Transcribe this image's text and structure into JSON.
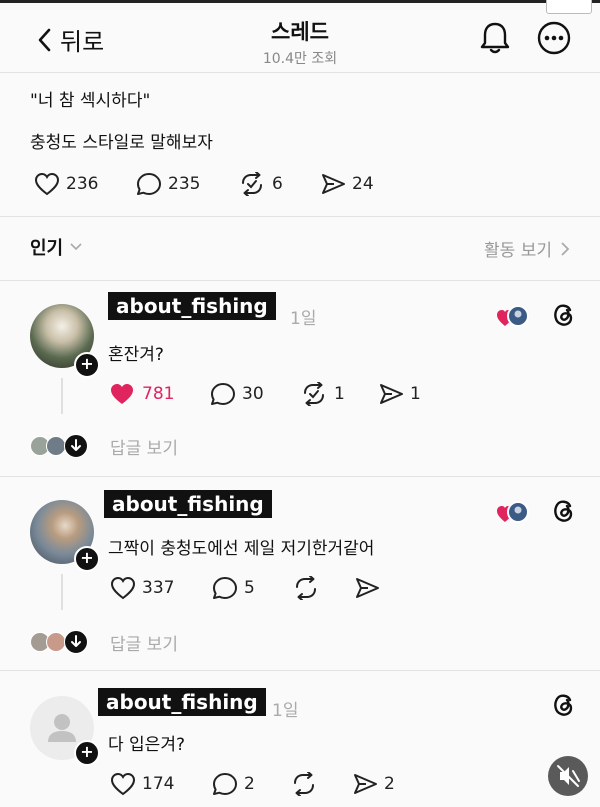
{
  "header": {
    "back_label": "뒤로",
    "title": "스레드",
    "views": "10.4만 조회"
  },
  "post": {
    "line1": "\"너 참 섹시하다\"",
    "line2": "충청도 스타일로 말해보자",
    "likes": "236",
    "comments": "235",
    "reposts": "6",
    "shares": "24"
  },
  "sort": {
    "label": "인기",
    "activity_label": "활동 보기"
  },
  "comments": [
    {
      "username": "about_fishing",
      "time": "1일",
      "text": "혼잔겨?",
      "likes": "781",
      "comments": "30",
      "reposts": "1",
      "shares": "1",
      "liked": true,
      "reply_label": "답글 보기"
    },
    {
      "username": "about_fishing",
      "time": "",
      "text": "그짝이 충청도에선 제일 저기한거같어",
      "likes": "337",
      "comments": "5",
      "reposts": "",
      "shares": "",
      "liked": false,
      "reply_label": "답글 보기"
    },
    {
      "username": "about_fishing",
      "time": "1일",
      "text": "다 입은겨?",
      "likes": "174",
      "comments": "2",
      "reposts": "",
      "shares": "2",
      "liked": false
    }
  ],
  "colors": {
    "like_active": "#e0245e",
    "muted_text": "#999999",
    "name_bg": "#111111"
  },
  "icons": [
    "chevron-left-icon",
    "bell-icon",
    "more-icon",
    "heart-icon",
    "comment-icon",
    "repost-icon",
    "share-icon",
    "threads-icon",
    "mute-icon",
    "plus-icon",
    "chevron-down-icon",
    "chevron-right-icon"
  ]
}
